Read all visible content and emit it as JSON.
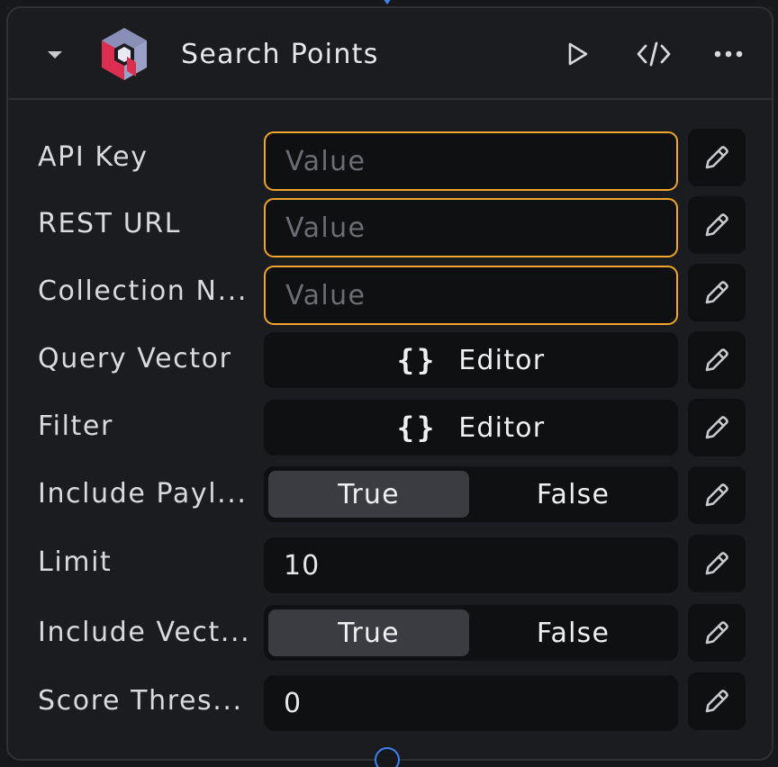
{
  "node": {
    "title": "Search Points",
    "icons": {
      "collapse": "caret-down-icon",
      "logo": "qdrant-logo",
      "run": "play-icon",
      "code": "code-icon",
      "more": "more-horizontal-icon",
      "edit": "pencil-icon"
    },
    "colors": {
      "required_border": "#f0a52b",
      "handle": "#3b82f6"
    }
  },
  "fields": {
    "api_key": {
      "label": "API Key",
      "placeholder": "Value"
    },
    "rest_url": {
      "label": "REST URL",
      "placeholder": "Value"
    },
    "collection_name": {
      "label": "Collection N...",
      "placeholder": "Value"
    },
    "query_vector": {
      "label": "Query Vector",
      "braces": "{}",
      "button": "Editor"
    },
    "filter": {
      "label": "Filter",
      "braces": "{}",
      "button": "Editor"
    },
    "include_payload": {
      "label": "Include Payl...",
      "true_label": "True",
      "false_label": "False",
      "selected": "True"
    },
    "limit": {
      "label": "Limit",
      "value": "10"
    },
    "include_vectors": {
      "label": "Include Vect...",
      "true_label": "True",
      "false_label": "False",
      "selected": "True"
    },
    "score_threshold": {
      "label": "Score Thres...",
      "value": "0"
    }
  }
}
